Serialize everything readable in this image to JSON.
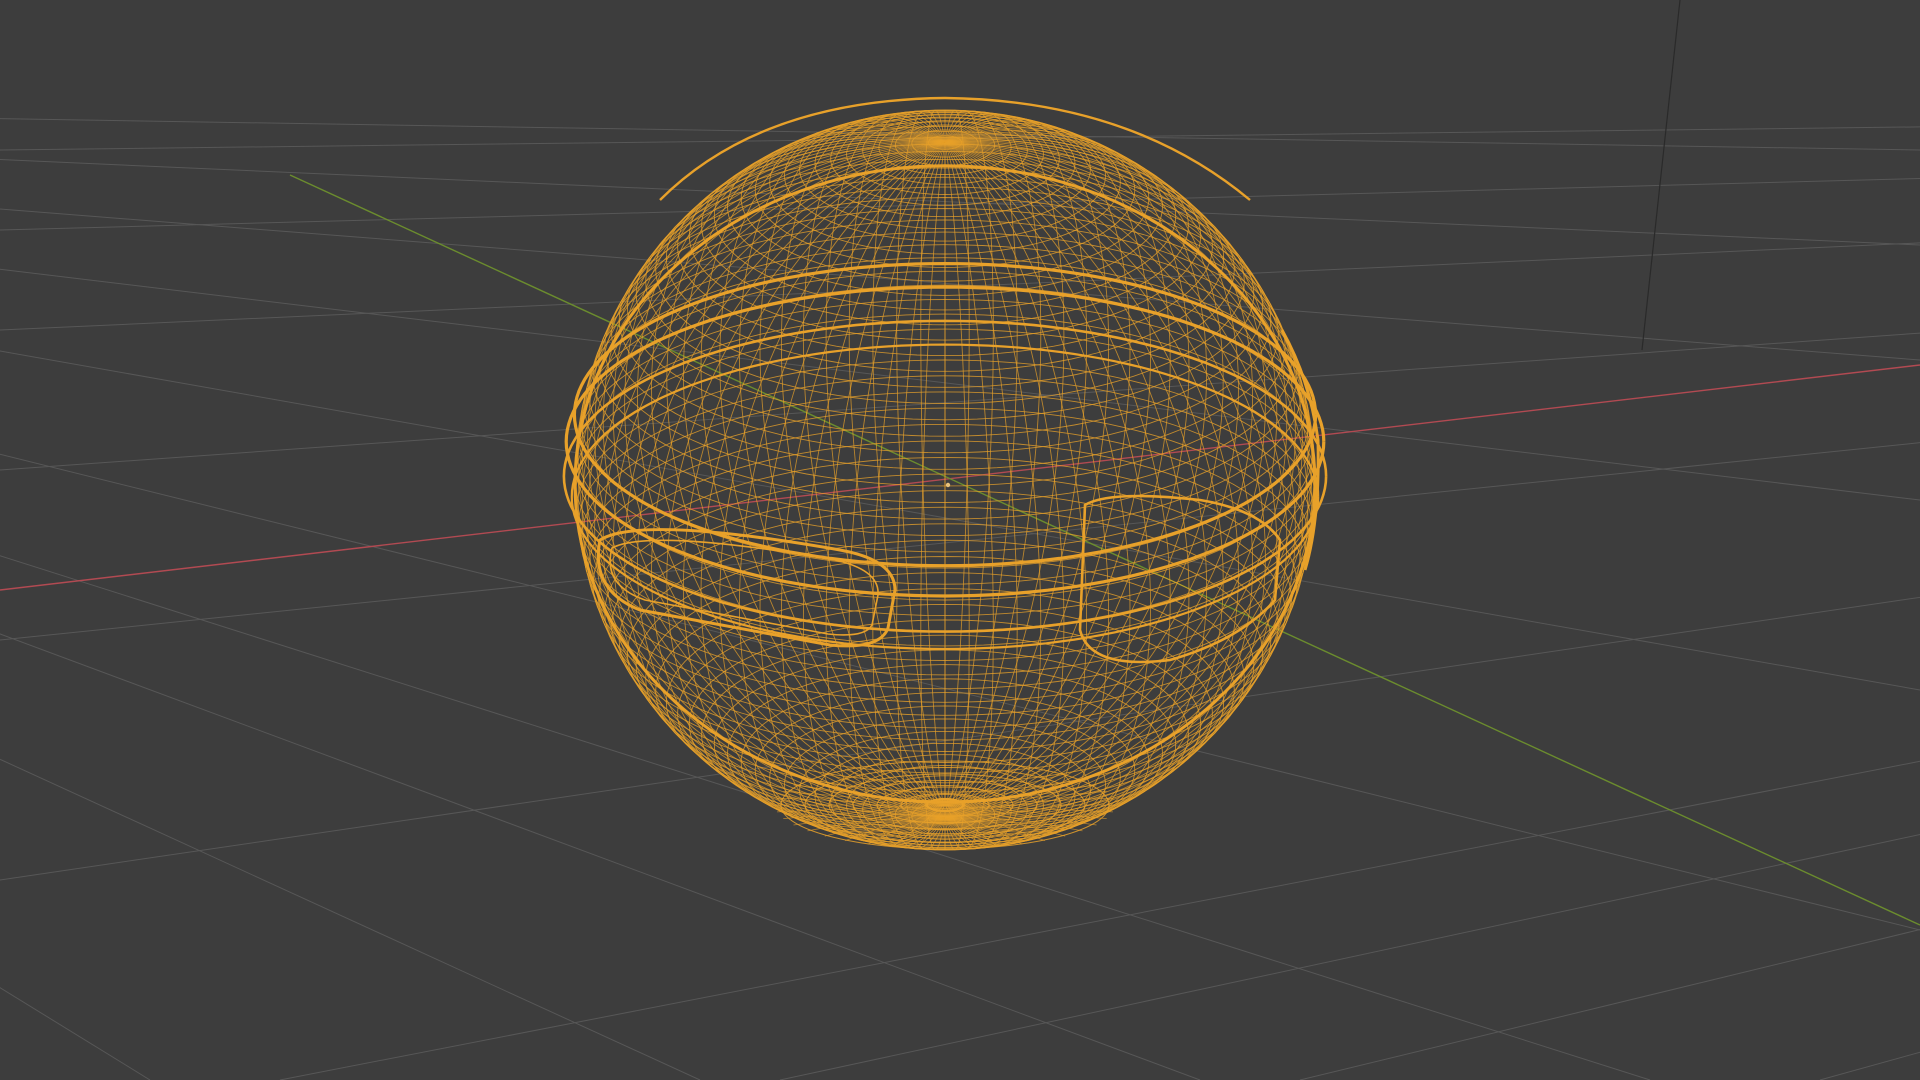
{
  "viewport": {
    "view": "3D Viewport",
    "shading": "wireframe",
    "background_color": "#3d3d3d",
    "grid_color": "#575757",
    "x_axis_color": "#b24a52",
    "y_axis_color": "#6b8c2e",
    "z_axis_color": "#2a2a2a",
    "origin_color": "#e8c27a"
  },
  "object": {
    "shape": "sphere-helmet",
    "selected": true,
    "wire_color": "#e8a12a",
    "features": [
      "visor-band",
      "side-cutouts",
      "pole-fan"
    ]
  }
}
